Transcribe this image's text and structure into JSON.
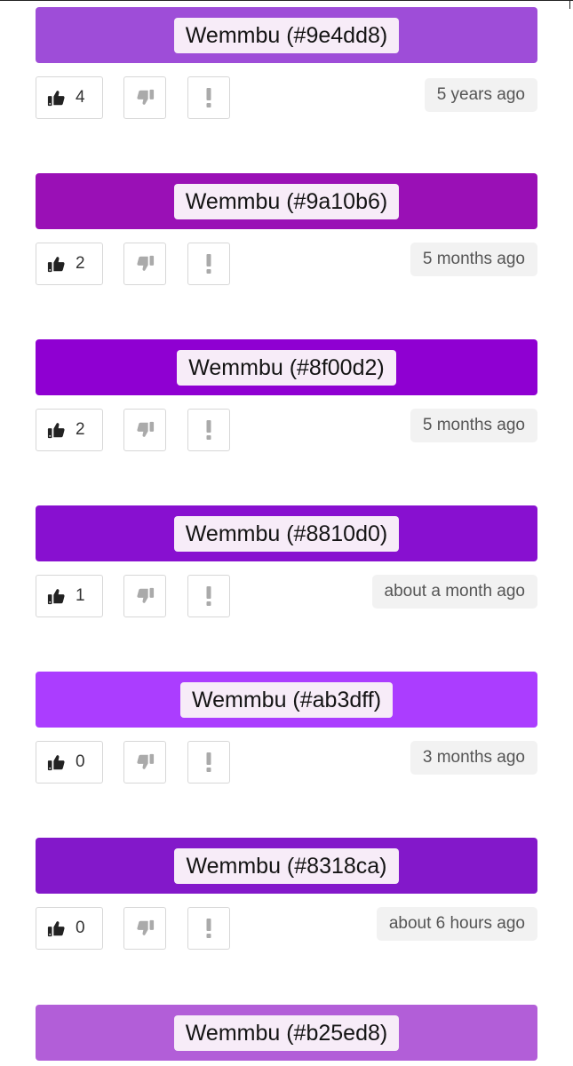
{
  "entries": [
    {
      "name": "Wemmbu (#9e4dd8)",
      "color": "#9e4dd8",
      "likes": "4",
      "time": "5 years ago"
    },
    {
      "name": "Wemmbu (#9a10b6)",
      "color": "#9a10b6",
      "likes": "2",
      "time": "5 months ago"
    },
    {
      "name": "Wemmbu (#8f00d2)",
      "color": "#8f00d2",
      "likes": "2",
      "time": "5 months ago"
    },
    {
      "name": "Wemmbu (#8810d0)",
      "color": "#8810d0",
      "likes": "1",
      "time": "about a month ago"
    },
    {
      "name": "Wemmbu (#ab3dff)",
      "color": "#ab3dff",
      "likes": "0",
      "time": "3 months ago"
    },
    {
      "name": "Wemmbu (#8318ca)",
      "color": "#8318ca",
      "likes": "0",
      "time": "about 6 hours ago"
    },
    {
      "name": "Wemmbu (#b25ed8)",
      "color": "#b25ed8"
    }
  ],
  "icons": {
    "like": "thumbs-up-icon",
    "dislike": "thumbs-down-icon",
    "flag": "exclamation-icon"
  }
}
